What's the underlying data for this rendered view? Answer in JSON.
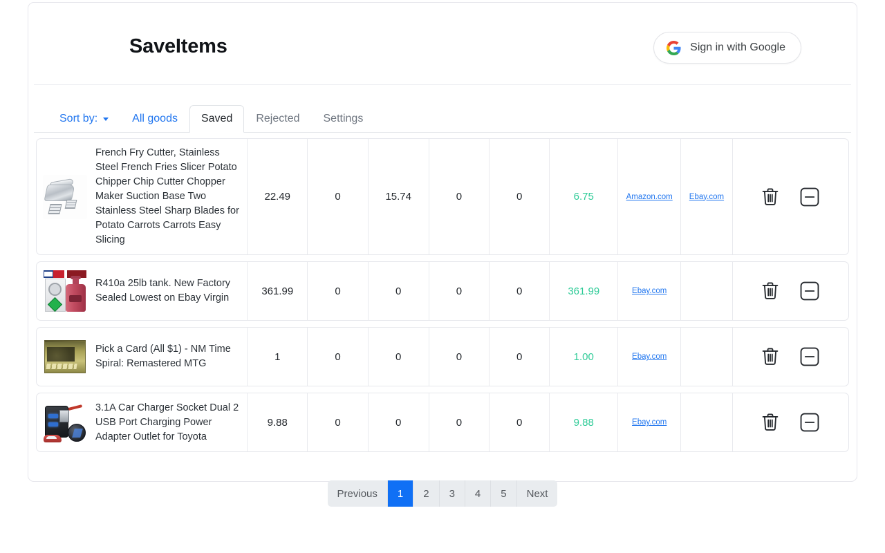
{
  "header": {
    "title": "SaveItems",
    "google_button": {
      "label": "Sign in with Google",
      "icon": "google-g-icon"
    }
  },
  "tabs": {
    "sort_by": {
      "label": "Sort by:",
      "caret_icon": "chevron-down-icon"
    },
    "items": [
      {
        "label": "All goods",
        "state": "link"
      },
      {
        "label": "Saved",
        "state": "active"
      },
      {
        "label": "Rejected",
        "state": "muted"
      },
      {
        "label": "Settings",
        "state": "muted"
      }
    ]
  },
  "table": {
    "rows": [
      {
        "thumb": "french-fry-cutter-thumbnail",
        "title": "French Fry Cutter, Stainless Steel French Fries Slicer Potato Chipper Chip Cutter Chopper Maker Suction Base Two Stainless Steel Sharp Blades for Potato Carrots Carrots Easy Slicing",
        "col1": "22.49",
        "col2": "0",
        "col3": "15.74",
        "col4": "0",
        "col5": "0",
        "price": "6.75",
        "link1": "Amazon.com",
        "link2": "Ebay.com",
        "delete_icon": "trash-icon",
        "reject_icon": "minus-square-icon"
      },
      {
        "thumb": "r410a-tank-thumbnail",
        "title": "R410a 25lb tank. New Factory Sealed Lowest on Ebay Virgin",
        "col1": "361.99",
        "col2": "0",
        "col3": "0",
        "col4": "0",
        "col5": "0",
        "price": "361.99",
        "link1": "Ebay.com",
        "link2": "",
        "delete_icon": "trash-icon",
        "reject_icon": "minus-square-icon"
      },
      {
        "thumb": "mtg-time-spiral-box-thumbnail",
        "title": "Pick a Card (All $1) - NM Time Spiral: Remastered MTG",
        "col1": "1",
        "col2": "0",
        "col3": "0",
        "col4": "0",
        "col5": "0",
        "price": "1.00",
        "link1": "Ebay.com",
        "link2": "",
        "delete_icon": "trash-icon",
        "reject_icon": "minus-square-icon"
      },
      {
        "thumb": "car-usb-charger-thumbnail",
        "title": "3.1A Car Charger Socket Dual 2 USB Port Charging Power Adapter Outlet for Toyota",
        "col1": "9.88",
        "col2": "0",
        "col3": "0",
        "col4": "0",
        "col5": "0",
        "price": "9.88",
        "link1": "Ebay.com",
        "link2": "",
        "delete_icon": "trash-icon",
        "reject_icon": "minus-square-icon"
      }
    ]
  },
  "pagination": {
    "previous_label": "Previous",
    "next_label": "Next",
    "pages": [
      "1",
      "2",
      "3",
      "4",
      "5"
    ],
    "current_page": "1"
  },
  "colors": {
    "accent_blue": "#1070f5",
    "link_blue": "#2176ef",
    "price_green": "#2ecb97",
    "border_gray": "#e6e7ec"
  }
}
